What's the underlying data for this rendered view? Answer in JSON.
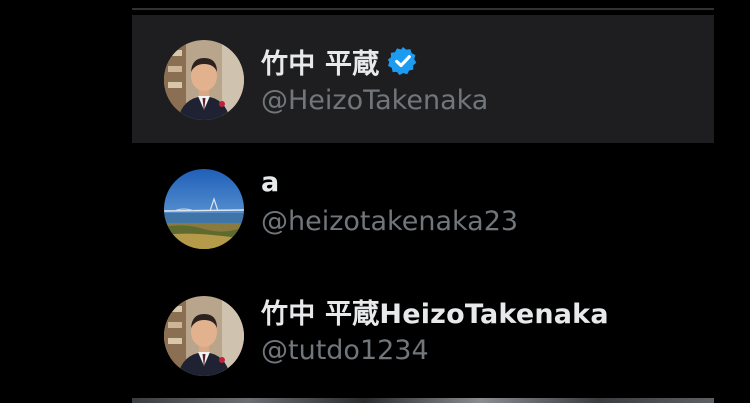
{
  "accounts": [
    {
      "display_name": "竹中 平蔵",
      "handle": "@HeizoTakenaka",
      "verified": true,
      "avatar": "portrait-man-in-suit",
      "active": true
    },
    {
      "display_name": "a",
      "handle": "@heizotakenaka23",
      "verified": false,
      "avatar": "landscape-bridge-photo",
      "active": false
    },
    {
      "display_name": "竹中 平蔵HeizoTakenaka",
      "handle": "@tutdo1234",
      "verified": false,
      "avatar": "portrait-man-in-suit",
      "active": false
    }
  ],
  "colors": {
    "background": "#000000",
    "active_row": "#1e1e21",
    "name_text": "#e7e9ea",
    "handle_text": "#71767b",
    "verified_badge": "#1d9bf0"
  }
}
